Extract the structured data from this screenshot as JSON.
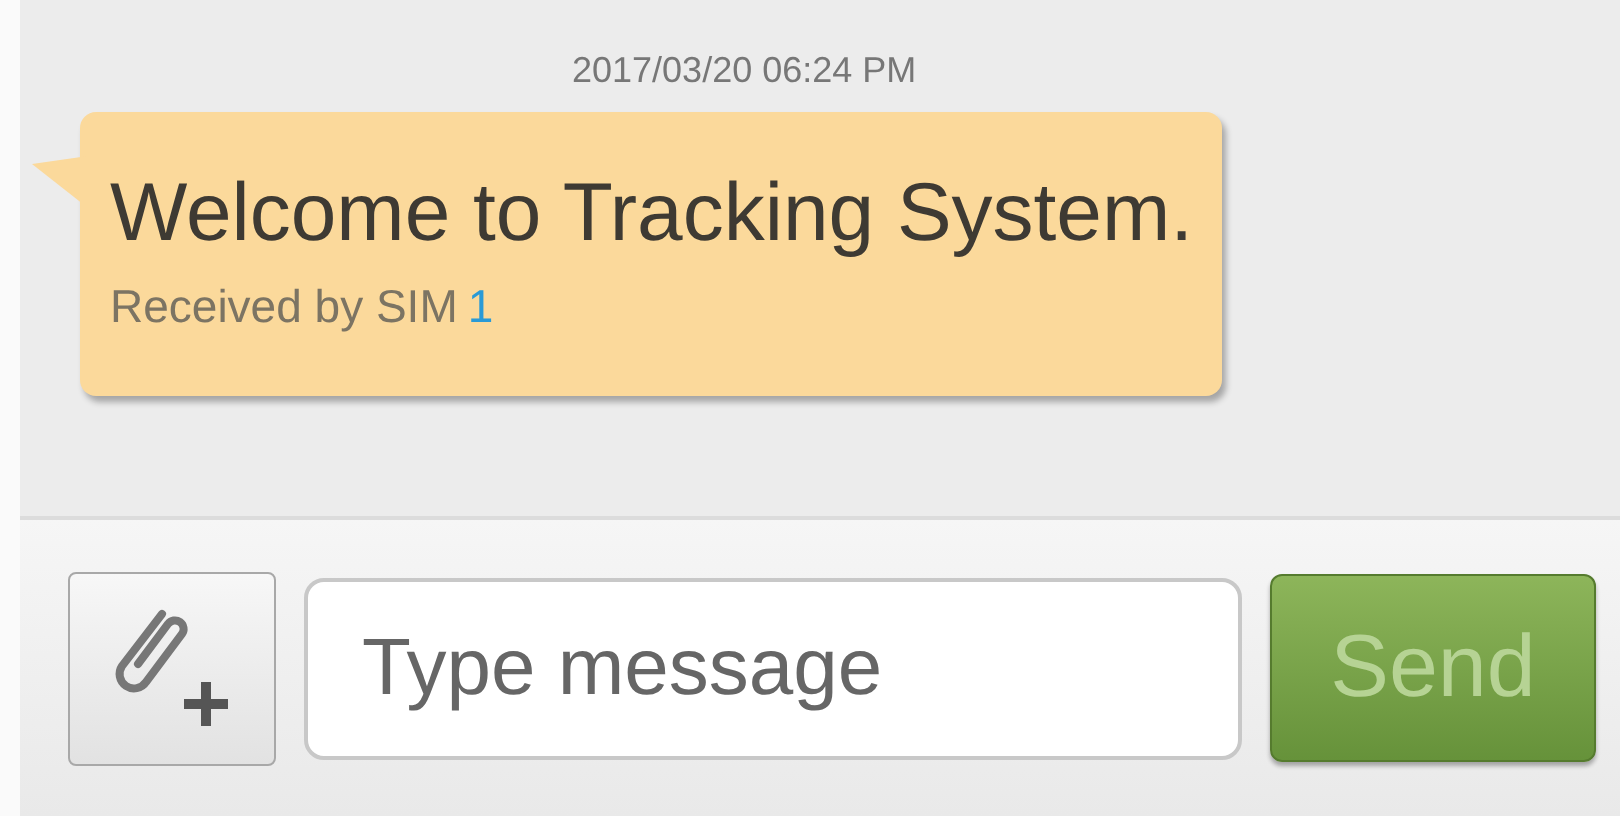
{
  "timestamp": "2017/03/20 06:24 PM",
  "message": {
    "text": "Welcome to Tracking System.",
    "received_by": "Received by SIM",
    "sim": "1"
  },
  "composer": {
    "placeholder": "Type message"
  },
  "send_button": {
    "label": "Send",
    "disabled": true
  }
}
